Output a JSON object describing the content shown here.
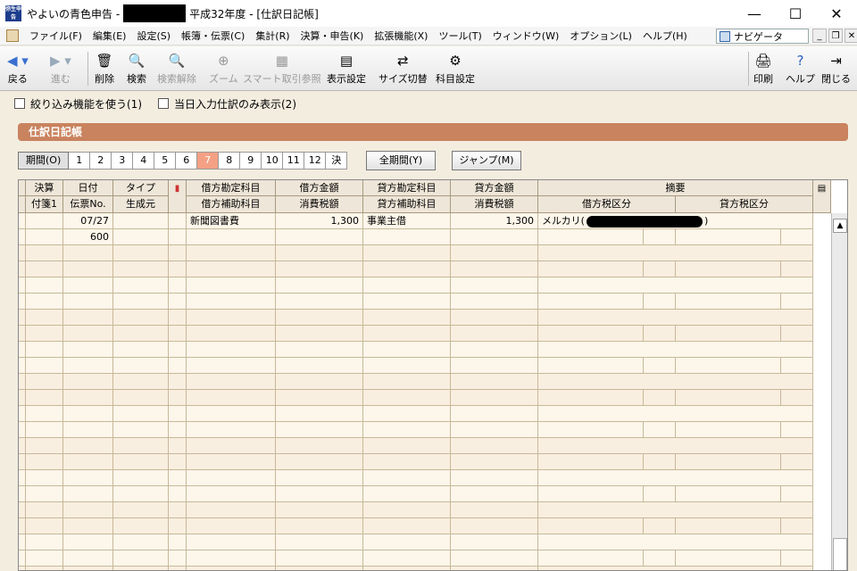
{
  "window": {
    "app_icon_text": "弥生申告",
    "title_prefix": "やよいの青色申告 -",
    "title_suffix": "平成32年度 - [仕訳日記帳]",
    "minimize": "—",
    "maximize": "☐",
    "close": "✕"
  },
  "menu": {
    "items": [
      "ファイル(F)",
      "編集(E)",
      "設定(S)",
      "帳簿・伝票(C)",
      "集計(R)",
      "決算・申告(K)",
      "拡張機能(X)",
      "ツール(T)",
      "ウィンドウ(W)",
      "オプション(L)",
      "ヘルプ(H)"
    ],
    "navigator_label": "ナビゲータ",
    "mdi_min": "_",
    "mdi_restore": "❐",
    "mdi_close": "✕"
  },
  "toolbar": {
    "back": "戻る",
    "forward": "進む",
    "delete": "削除",
    "search": "検索",
    "unselect": "検索解除",
    "zoom": "ズーム",
    "smart": "スマート取引参照",
    "display_settings": "表示設定",
    "size_switch": "サイズ切替",
    "account_settings": "科目設定",
    "print": "印刷",
    "help": "ヘルプ",
    "close": "閉じる"
  },
  "filters": {
    "use_filter": "絞り込み機能を使う(1)",
    "today_only": "当日入力仕訳のみ表示(2)"
  },
  "section": {
    "title": "仕訳日記帳"
  },
  "period": {
    "label": "期間(O)",
    "buttons": [
      "1",
      "2",
      "3",
      "4",
      "5",
      "6",
      "7",
      "8",
      "9",
      "10",
      "11",
      "12",
      "決"
    ],
    "active": "7",
    "all_period": "全期間(Y)",
    "jump": "ジャンプ(M)"
  },
  "grid": {
    "header_row1": [
      "決算",
      "日付",
      "タイプ",
      "",
      "借方勘定科目",
      "借方金額",
      "貸方勘定科目",
      "貸方金額",
      "摘要"
    ],
    "header_row2": [
      "付箋1",
      "伝票No.",
      "生成元",
      "",
      "借方補助科目",
      "消費税額",
      "貸方補助科目",
      "消費税額",
      "借方税区分",
      "貸方税区分"
    ],
    "entry": {
      "date": "07/27",
      "voucher_no": "600",
      "debit_account": "新聞図書費",
      "debit_amount": "1,300",
      "credit_account": "事業主借",
      "credit_amount": "1,300",
      "memo_prefix": "メルカリ(",
      "memo_suffix": ")"
    }
  }
}
